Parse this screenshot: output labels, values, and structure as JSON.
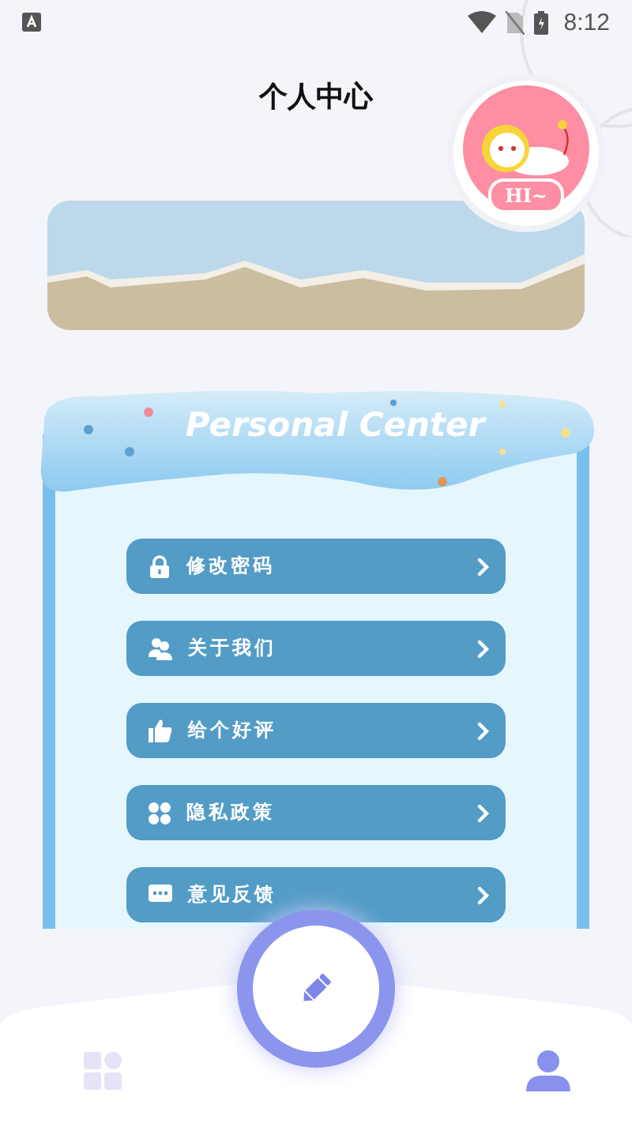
{
  "status_bar": {
    "time": "8:12"
  },
  "header": {
    "title": "个人中心"
  },
  "avatar": {
    "badge": "HI~"
  },
  "card": {
    "title": "Personal Center"
  },
  "menu": [
    {
      "label": "修改密码",
      "kind": "lock"
    },
    {
      "label": "关于我们",
      "kind": "users"
    },
    {
      "label": "给个好评",
      "kind": "thumb"
    },
    {
      "label": "隐私政策",
      "kind": "grid"
    },
    {
      "label": "意见反馈",
      "kind": "chat"
    }
  ],
  "nav": [
    {
      "kind": "grid",
      "selected": false
    },
    {
      "kind": "person",
      "selected": true
    }
  ]
}
